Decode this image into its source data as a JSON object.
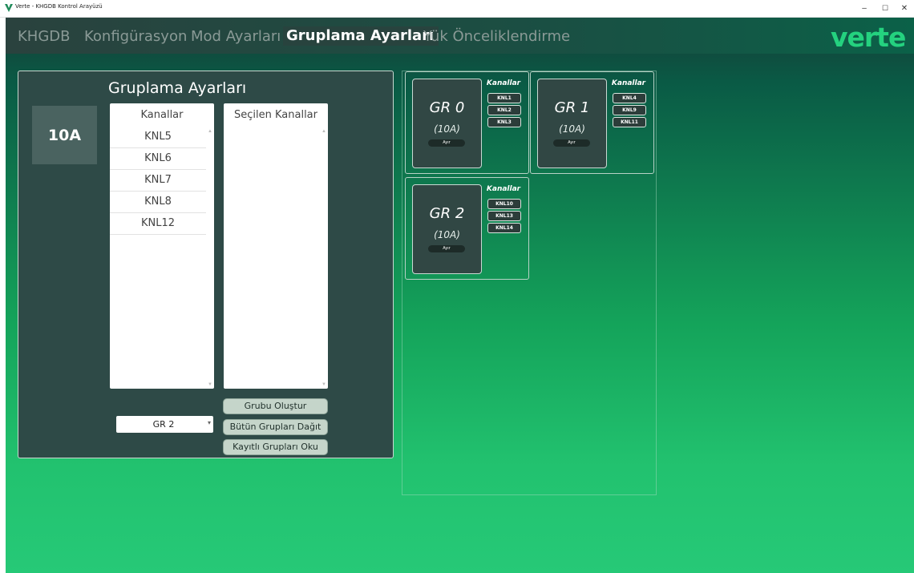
{
  "window": {
    "title": "Verte - KHGDB Kontrol Arayüzü",
    "controls": {
      "minimize": "–",
      "maximize": "☐",
      "close": "✕"
    }
  },
  "nav": {
    "tabs": [
      "KHGDB",
      "Konfigürasyon",
      "Mod Ayarları",
      "Gruplama Ayarları",
      "Yük Önceliklendirme"
    ],
    "active": "Gruplama Ayarları",
    "brand": "verte"
  },
  "panel": {
    "title": "Gruplama Ayarları",
    "amp": "10A",
    "available_header": "Kanallar",
    "available_items": [
      "KNL5",
      "KNL6",
      "KNL7",
      "KNL8",
      "KNL12"
    ],
    "selected_header": "Seçilen Kanallar",
    "selected_items": [],
    "select_value": "GR 2",
    "buttons": {
      "create": "Grubu Oluştur",
      "disband_all": "Bütün Grupları Dağıt",
      "read_saved": "Kayıtlı Grupları Oku"
    }
  },
  "groups": [
    {
      "name": "GR 0",
      "amp": "(10A)",
      "button": "Ayır",
      "kanal_label": "Kanallar",
      "channels": [
        "KNL1",
        "KNL2",
        "KNL3"
      ]
    },
    {
      "name": "GR 1",
      "amp": "(10A)",
      "button": "Ayır",
      "kanal_label": "Kanallar",
      "channels": [
        "KNL4",
        "KNL9",
        "KNL11"
      ]
    },
    {
      "name": "GR 2",
      "amp": "(10A)",
      "button": "Ayır",
      "kanal_label": "Kanallar",
      "channels": [
        "KNL10",
        "KNL13",
        "KNL14"
      ]
    }
  ],
  "colors": {
    "brand": "#24d27f",
    "panel_bg": "#2e4a47",
    "gradient_top": "#163c37",
    "gradient_bottom": "#26c977"
  }
}
